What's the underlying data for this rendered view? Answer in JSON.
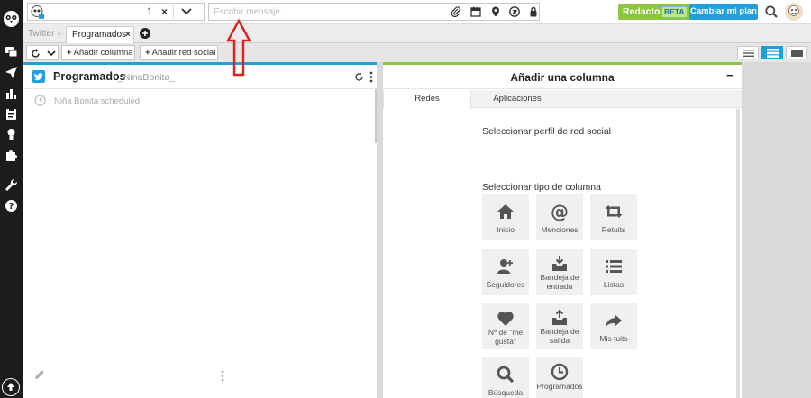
{
  "topbar": {
    "profile_count": "1",
    "remove_label": "×",
    "compose_placeholder": "Escribir mensaje...",
    "redactor_label": "Redactor",
    "beta_label": "BETA",
    "plan_label": "Cambiar mi plan"
  },
  "tabs": [
    {
      "label": "Twitter",
      "close": "×"
    },
    {
      "label": "Programados",
      "close": "×"
    }
  ],
  "toolbar": {
    "add_column": "Añadir columna",
    "add_network": "Añadir red social"
  },
  "column": {
    "title": "Programados",
    "account": "_NinaBonita_",
    "scheduled_text": "Niña Bonita scheduled"
  },
  "add_panel": {
    "title": "Añadir una columna",
    "minimize": "−",
    "tabs": [
      "Redes",
      "Aplicaciones"
    ],
    "select_profile": "Seleccionar perfil de red social",
    "select_type": "Seleccionar tipo de columna",
    "tiles": [
      "Inicio",
      "Menciones",
      "Retuits",
      "Seguidores",
      "Bandeja de entrada",
      "Listas",
      "Nº de \"me gusta\"",
      "Bandeja de salida",
      "Mis tuits",
      "Búsqueda",
      "Programados"
    ]
  },
  "colors": {
    "sidebar": "#1c1c1c",
    "accent_blue": "#1fa0dc",
    "accent_green": "#8cc63e",
    "annotation_red": "#e0201b"
  }
}
